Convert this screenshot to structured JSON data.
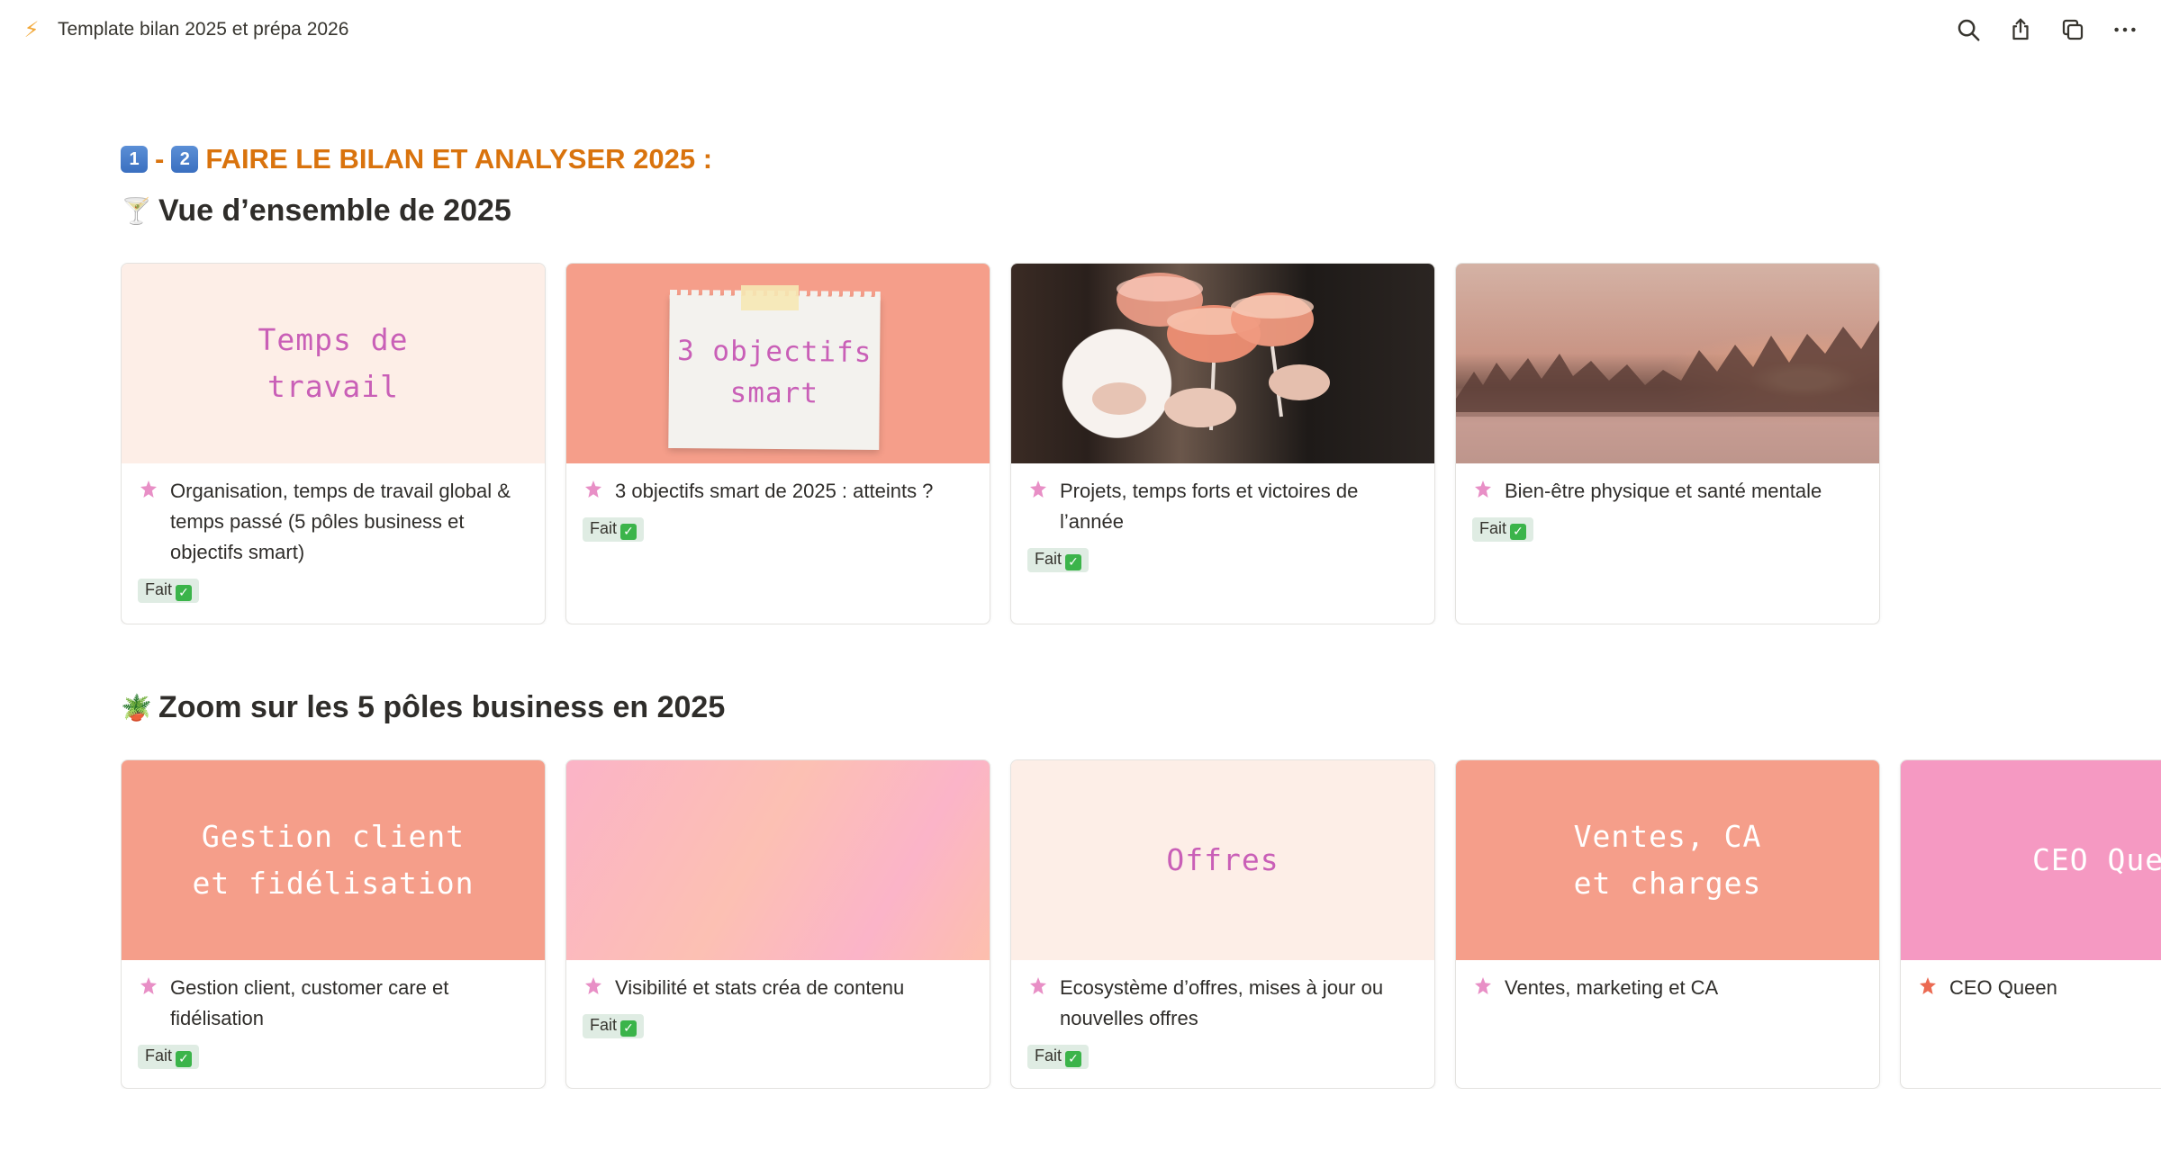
{
  "topbar": {
    "emoji": "⚡",
    "title": "Template bilan 2025 et prépa 2026"
  },
  "section": {
    "key1": "1",
    "separator": "-",
    "key2": "2",
    "title": "FAIRE LE BILAN ET ANALYSER 2025 :",
    "color": "#d9730d"
  },
  "overview": {
    "emoji": "🍸",
    "title": "Vue d’ensemble de 2025",
    "cards": [
      {
        "cover_text": "Temps de\ntravail",
        "cover_bg": "#fdeee7",
        "cover_text_color": "#c95fb7",
        "title": "Organisation, temps de travail global & temps passé (5 pôles business et objectifs smart)",
        "status": "Fait",
        "icon": "pink-star-icon"
      },
      {
        "cover_text": "3 objectifs\nsmart",
        "cover_bg": "#f59e8a",
        "cover_text_color": "#c95fb7",
        "title": "3 objectifs smart de 2025 : atteints ?",
        "status": "Fait",
        "icon": "pink-star-icon"
      },
      {
        "cover_text": "",
        "title": "Projets, temps forts et victoires de l’année",
        "status": "Fait",
        "icon": "pink-star-icon"
      },
      {
        "cover_text": "",
        "title": "Bien-être physique et santé mentale",
        "status": "Fait",
        "icon": "pink-star-icon"
      }
    ]
  },
  "zoom": {
    "emoji": "🪴",
    "title": "Zoom sur les 5 pôles business en 2025",
    "cards": [
      {
        "cover_text": "Gestion client\net fidélisation",
        "cover_bg": "#f59e8a",
        "cover_text_color": "#ffffff",
        "title": "Gestion client, customer care et fidélisation",
        "status": "Fait",
        "icon": "pink-star-icon"
      },
      {
        "cover_text": "",
        "title": "Visibilité et stats créa de contenu",
        "status": "Fait",
        "icon": "pink-star-icon"
      },
      {
        "cover_text": "Offres",
        "cover_bg": "#fdeee7",
        "cover_text_color": "#c95fb7",
        "title": "Ecosystème d’offres, mises à jour ou nouvelles offres",
        "status": "Fait",
        "icon": "pink-star-icon"
      },
      {
        "cover_text": "Ventes, CA\net charges",
        "cover_bg": "#f59e8a",
        "cover_text_color": "#ffffff",
        "title": "Ventes, marketing et CA",
        "status": "",
        "icon": "pink-star-icon"
      },
      {
        "cover_text": "CEO Queen",
        "cover_bg": "#f599c2",
        "cover_text_color": "#ffffff",
        "title": "CEO Queen",
        "status": "",
        "icon": "red-star-icon"
      }
    ]
  },
  "colors": {
    "star_pink": "#e88fc6",
    "star_red": "#eb6a52",
    "badge_bg": "#dfece3",
    "check_green": "#3bb44a"
  }
}
